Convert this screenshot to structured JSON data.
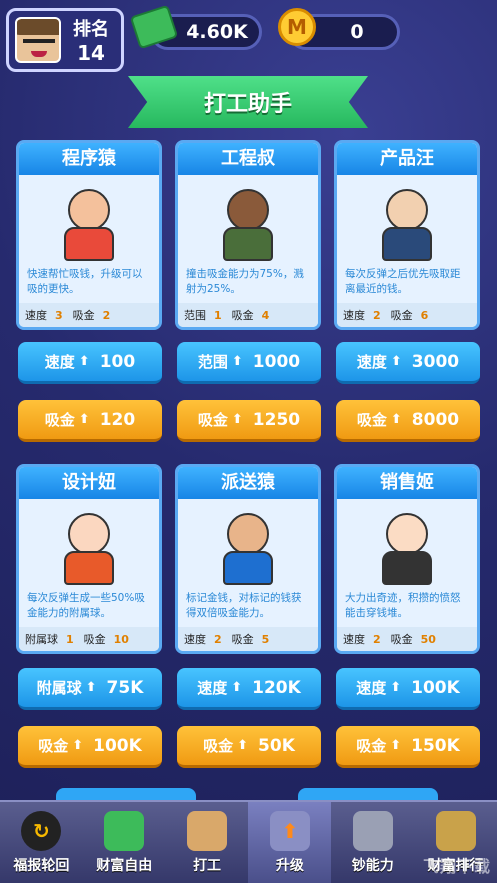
{
  "player": {
    "rank_label": "排名",
    "rank_value": "14"
  },
  "currency": {
    "cash": "4.60K",
    "coins": "0",
    "coin_glyph": "M"
  },
  "banner": {
    "title": "打工助手"
  },
  "cards": [
    {
      "title": "程序猿",
      "desc": "快速帮忙吸钱，升级可以吸的更快。",
      "stat1_label": "速度",
      "stat1_value": "3",
      "stat2_label": "吸金",
      "stat2_value": "2",
      "btn1_label": "速度",
      "btn1_value": "100",
      "btn2_label": "吸金",
      "btn2_value": "120"
    },
    {
      "title": "工程叔",
      "desc": "撞击吸金能力为75%，溅射为25%。",
      "stat1_label": "范围",
      "stat1_value": "1",
      "stat2_label": "吸金",
      "stat2_value": "4",
      "btn1_label": "范围",
      "btn1_value": "1000",
      "btn2_label": "吸金",
      "btn2_value": "1250"
    },
    {
      "title": "产品汪",
      "desc": "每次反弹之后优先吸取距离最近的钱。",
      "stat1_label": "速度",
      "stat1_value": "2",
      "stat2_label": "吸金",
      "stat2_value": "6",
      "btn1_label": "速度",
      "btn1_value": "3000",
      "btn2_label": "吸金",
      "btn2_value": "8000"
    },
    {
      "title": "设计妞",
      "desc": "每次反弹生成一些50%吸金能力的附属球。",
      "stat1_label": "附属球",
      "stat1_value": "1",
      "stat2_label": "吸金",
      "stat2_value": "10",
      "btn1_label": "附属球",
      "btn1_value": "75K",
      "btn2_label": "吸金",
      "btn2_value": "100K"
    },
    {
      "title": "派送猿",
      "desc": "标记金钱，对标记的钱获得双倍吸金能力。",
      "stat1_label": "速度",
      "stat1_value": "2",
      "stat2_label": "吸金",
      "stat2_value": "5",
      "btn1_label": "速度",
      "btn1_value": "120K",
      "btn2_label": "吸金",
      "btn2_value": "50K"
    },
    {
      "title": "销售姬",
      "desc": "大力出奇迹，积攒的愤怒能击穿钱堆。",
      "stat1_label": "速度",
      "stat1_value": "2",
      "stat2_label": "吸金",
      "stat2_value": "50",
      "btn1_label": "速度",
      "btn1_value": "100K",
      "btn2_label": "吸金",
      "btn2_value": "150K"
    }
  ],
  "nav": [
    {
      "label": "福报轮回",
      "icon": "wheel-icon"
    },
    {
      "label": "财富自由",
      "icon": "money-wings-icon"
    },
    {
      "label": "打工",
      "icon": "box-icon"
    },
    {
      "label": "升级",
      "icon": "upgrade-arrow-icon"
    },
    {
      "label": "钞能力",
      "icon": "cash-machine-icon"
    },
    {
      "label": "财富排行",
      "icon": "ranking-icon"
    }
  ],
  "watermark": "飞翔下载",
  "colors": {
    "accent_blue": "#1d95e8",
    "accent_orange": "#f09a12",
    "banner_green": "#27b85e"
  }
}
